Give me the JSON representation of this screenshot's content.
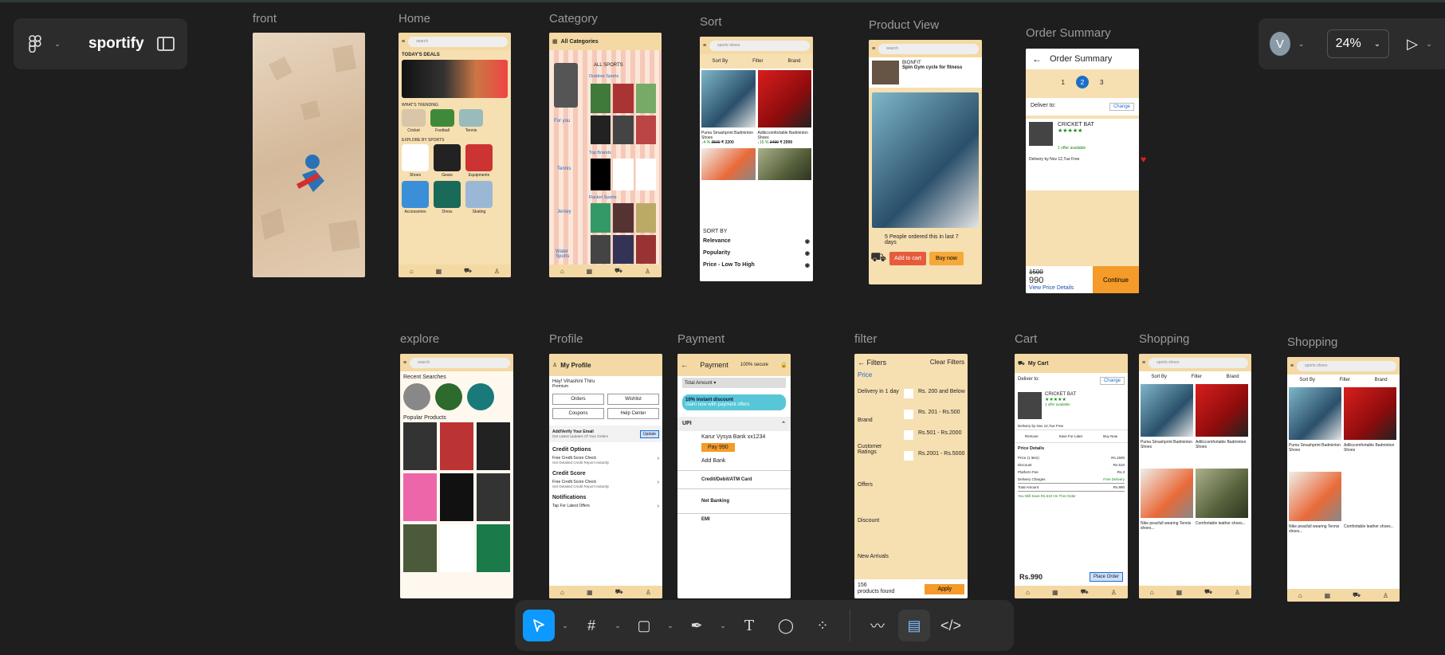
{
  "project": {
    "name": "sportify",
    "user_initial": "V",
    "zoom": "24%"
  },
  "frames": {
    "front": "front",
    "home": "Home",
    "category": "Category",
    "sort": "Sort",
    "product_view": "Product View",
    "order_summary": "Order Summary",
    "explore": "explore",
    "profile": "Profile",
    "payment": "Payment",
    "filter": "filter",
    "cart": "Cart",
    "shopping1": "Shopping",
    "shopping2": "Shopping"
  },
  "home": {
    "search": "search",
    "deals": "TODAY'S DEALS",
    "trending": "WHAT'S TRENDING",
    "trend_items": [
      "Cricket",
      "Football",
      "Tennis"
    ],
    "explore": "EXPLORE BY SPORTS",
    "row1": [
      "Shoes",
      "Gears",
      "Equipments"
    ],
    "row2": [
      "Accessories",
      "Dress",
      "Skating"
    ]
  },
  "category": {
    "title": "All Categories",
    "all_sports": "ALL SPORTS",
    "outdoor": "Outdoor Sports",
    "for_you": "For you",
    "tennis": "Tennis",
    "top_brands": "Top Brands",
    "jersey": "Jersey",
    "racket": "Racket Sports",
    "water": "Water Sports"
  },
  "sort": {
    "search": "sports shoes",
    "sort_by": "Sort By",
    "filter": "Filter",
    "brand": "Brand",
    "p1": "Puma Smashprint Badminton Shoes",
    "p1_price": "₹ 2200",
    "p1_old": "2500",
    "p1_off": "↓4 %",
    "p2": "Adiliccomfortable Badminton Shoes",
    "p2_price": "₹ 2999",
    "p2_old": "3499",
    "p2_off": "↓15 %",
    "sort_title": "SORT BY",
    "options": [
      "Relevance",
      "Popularity",
      "Price - Low To High"
    ]
  },
  "product": {
    "search": "search",
    "brand": "BIONFIT",
    "name": "Spin Gym cycle for fitness",
    "ordered": "5 People ordered this in last 7 days",
    "add": "Add to cart",
    "buy": "Buy now"
  },
  "order": {
    "title": "Order Summary",
    "steps": [
      "1",
      "2",
      "3"
    ],
    "deliver": "Deliver to:",
    "change": "Change",
    "item": "CRICKET BAT",
    "offer": "1 offer available",
    "delivery": "Delivery by Nov 12,Tue Free",
    "old": "1500",
    "price": "990",
    "details": "View Price Details",
    "continue": "Continue"
  },
  "explore": {
    "search": "search",
    "recent": "Recent Searches",
    "popular": "Popular Products"
  },
  "profile": {
    "title": "My Profile",
    "greet": "Hey! Vihashini Thiru",
    "premium": "Premium",
    "orders": "Orders",
    "wishlist": "Wishlist",
    "coupons": "Coupons",
    "help": "Help Center",
    "email": "Add/Verify Your Email",
    "email_sub": "Get Latest Updates Of Your Orders",
    "update": "Update",
    "credit": "Credit Options",
    "credit_item": "Free Credit Score Check",
    "credit_sub": "Get Detailed Credit Report Instantly",
    "score": "Credit Score",
    "notif": "Notifications",
    "notif_item": "Tap For Latest Offers"
  },
  "payment": {
    "title": "Payment",
    "secure": "100% secure",
    "total": "Total Amount",
    "discount": "10% instant discount",
    "discount_sub": "claim now with payment offers",
    "upi": "UPI",
    "bank": "Karur Vysya Bank xx1234",
    "pay": "Pay 990",
    "add_bank": "Add Bank",
    "card": "Credit/Debit/ATM Card",
    "net": "Net Banking",
    "emi": "EMI"
  },
  "filter": {
    "title": "Filters",
    "clear": "Clear Filters",
    "price": "Price",
    "left": [
      "Delivery in 1 day",
      "Brand",
      "Customer Ratings",
      "Offers",
      "Discount",
      "New Arrivals"
    ],
    "ranges": [
      "Rs. 200 and Below",
      "Rs. 201 - Rs.500",
      "Rs.501 - Rs.2000",
      "Rs.2001 - Rs.5000"
    ],
    "count": "156",
    "count_label": "products found",
    "apply": "Apply"
  },
  "cart": {
    "title": "My Cart",
    "deliver": "Deliver to:",
    "change": "Change",
    "item": "CRICKET BAT",
    "offer": "1 offer available",
    "delivery": "Delivery by Nov 12,Tue Free",
    "remove": "Remove",
    "save": "Save For Later",
    "buy": "Buy Now",
    "details_title": "Price Details",
    "rows": [
      [
        "Price (1 item)",
        "Rs.1500"
      ],
      [
        "Discount",
        "Rs.510"
      ],
      [
        "Platform Fee",
        "Rs.3"
      ],
      [
        "Delivery Charges",
        "Free Delivery"
      ],
      [
        "Total Amount",
        "Rs.990"
      ]
    ],
    "save_msg": "You Will Save Rs.510 On This Order",
    "total": "Rs.990",
    "place": "Place Order"
  },
  "shopping": {
    "search": "sports shoes",
    "sort_by": "Sort By",
    "filter": "Filter",
    "brand": "Brand",
    "p1": "Puma Smashprint Badminton Shoes",
    "p2": "Adiliccomfortable Badminton Shoes",
    "p3": "Nike peacfull wearing Tennis shoes...",
    "p4": "Comfortable leather shoes..."
  }
}
